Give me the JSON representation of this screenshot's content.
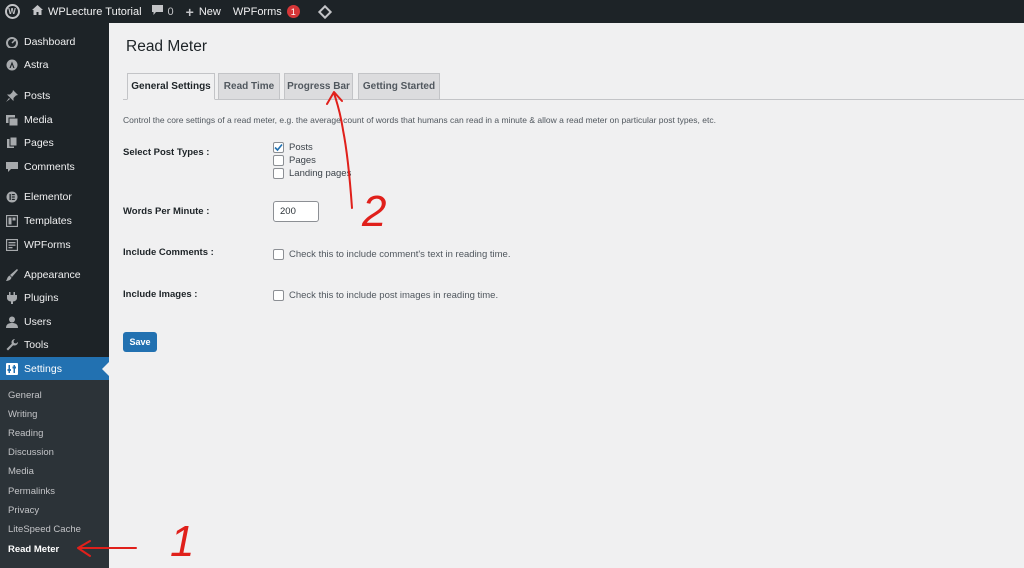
{
  "adminbar": {
    "site_name": "WPLecture Tutorial",
    "comments_count": "0",
    "new_label": "New",
    "wpforms_label": "WPForms",
    "wpforms_badge": "1"
  },
  "sidebar": {
    "items": [
      {
        "label": "Dashboard",
        "icon": "dashboard-icon"
      },
      {
        "label": "Astra",
        "icon": "astra-icon"
      },
      {
        "label": "Posts",
        "icon": "pin-icon"
      },
      {
        "label": "Media",
        "icon": "media-icon"
      },
      {
        "label": "Pages",
        "icon": "pages-icon"
      },
      {
        "label": "Comments",
        "icon": "comments-icon"
      },
      {
        "label": "Elementor",
        "icon": "elementor-icon"
      },
      {
        "label": "Templates",
        "icon": "templates-icon"
      },
      {
        "label": "WPForms",
        "icon": "wpforms-icon"
      },
      {
        "label": "Appearance",
        "icon": "brush-icon"
      },
      {
        "label": "Plugins",
        "icon": "plugin-icon"
      },
      {
        "label": "Users",
        "icon": "user-icon"
      },
      {
        "label": "Tools",
        "icon": "wrench-icon"
      },
      {
        "label": "Settings",
        "icon": "settings-icon"
      }
    ],
    "submenu": [
      "General",
      "Writing",
      "Reading",
      "Discussion",
      "Media",
      "Permalinks",
      "Privacy",
      "LiteSpeed Cache",
      "Read Meter"
    ],
    "active_color": "#2271b1"
  },
  "page": {
    "title": "Read Meter",
    "tabs": [
      "General Settings",
      "Read Time",
      "Progress Bar",
      "Getting Started"
    ],
    "description": "Control the core settings of a read meter, e.g. the average count of words that humans can read in a minute & allow a read meter on particular post types, etc.",
    "post_types_label": "Select Post Types :",
    "post_types": [
      {
        "label": "Posts",
        "checked": true
      },
      {
        "label": "Pages",
        "checked": false
      },
      {
        "label": "Landing pages",
        "checked": false
      }
    ],
    "wpm_label": "Words Per Minute :",
    "wpm_value": "200",
    "comments_label": "Include Comments :",
    "comments_text": "Check this to include comment's text in reading time.",
    "images_label": "Include Images :",
    "images_text": "Check this to include post images in reading time.",
    "save_label": "Save"
  },
  "annotations": {
    "mark_1": "1",
    "mark_2": "2",
    "color": "#e0201b"
  }
}
